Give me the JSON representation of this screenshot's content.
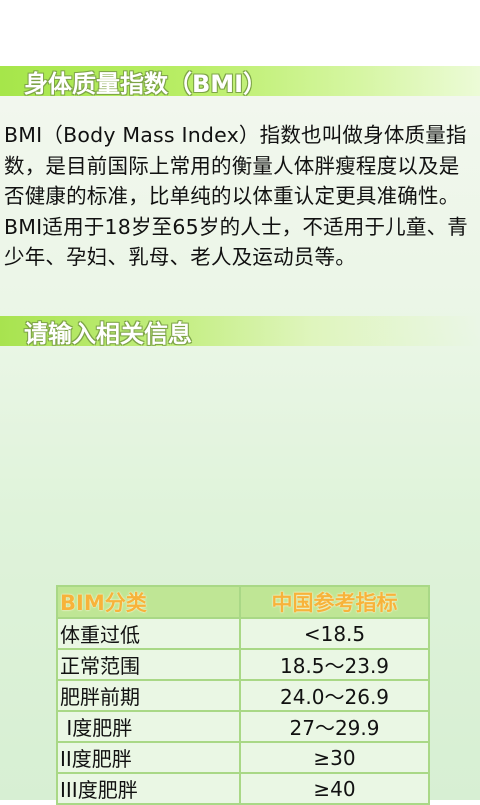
{
  "header": {
    "title": "身体质量指数（BMI）"
  },
  "intro": {
    "text": "BMI（Body Mass Index）指数也叫做身体质量指数，是目前国际上常用的衡量人体胖瘦程度以及是否健康的标准，比单纯的以体重认定更具准确性。BMI适用于18岁至65岁的人士，不适用于儿童、青少年、孕妇、乳母、老人及运动员等。"
  },
  "input_section": {
    "title": "请输入相关信息"
  },
  "table": {
    "headers": [
      "BIM分类",
      "中国参考指标"
    ],
    "rows": [
      {
        "category": "体重过低",
        "reference": "<18.5"
      },
      {
        "category": "正常范围",
        "reference": "18.5～23.9"
      },
      {
        "category": "肥胖前期",
        "reference": "24.0～26.9"
      },
      {
        "category": " I度肥胖",
        "reference": "27～29.9"
      },
      {
        "category": "II度肥胖",
        "reference": "≥30"
      },
      {
        "category": "III度肥胖",
        "reference": "≥40"
      }
    ]
  },
  "colors": {
    "bar_green": "#a6e64a",
    "header_cell": "#bfe695",
    "header_text": "#f7b33a",
    "border": "#a9d886"
  }
}
